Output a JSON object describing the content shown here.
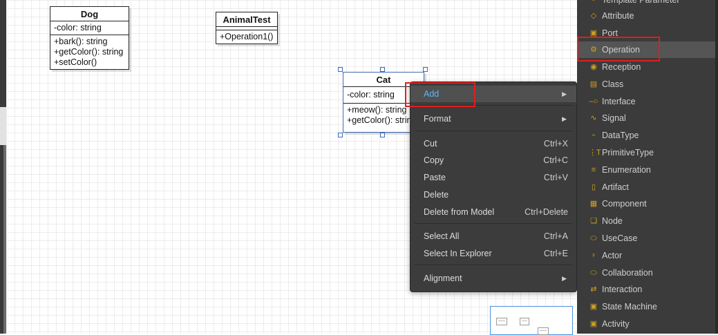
{
  "diagram": {
    "classes": [
      {
        "name": "Dog",
        "attributes": [
          "-color: string"
        ],
        "operations": [
          "+bark(): string",
          "+getColor(): string",
          "+setColor()"
        ]
      },
      {
        "name": "AnimalTest",
        "attributes": [],
        "operations": [
          "+Operation1()"
        ]
      },
      {
        "name": "Cat",
        "attributes": [
          "-color: string"
        ],
        "operations": [
          "+meow(): string",
          "+getColor(): string"
        ]
      }
    ]
  },
  "context_menu": {
    "items": [
      {
        "label": "Add",
        "shortcut": "",
        "submenu": true,
        "active": true
      },
      {
        "label": "Format",
        "shortcut": "",
        "submenu": true
      },
      {
        "label": "Cut",
        "shortcut": "Ctrl+X"
      },
      {
        "label": "Copy",
        "shortcut": "Ctrl+C"
      },
      {
        "label": "Paste",
        "shortcut": "Ctrl+V"
      },
      {
        "label": "Delete",
        "shortcut": ""
      },
      {
        "label": "Delete from Model",
        "shortcut": "Ctrl+Delete"
      },
      {
        "label": "Select All",
        "shortcut": "Ctrl+A"
      },
      {
        "label": "Select In Explorer",
        "shortcut": "Ctrl+E"
      },
      {
        "label": "Alignment",
        "shortcut": "",
        "submenu": true
      }
    ]
  },
  "palette": {
    "items": [
      {
        "label": "Template Parameter",
        "icon": "template-parameter-icon"
      },
      {
        "label": "Attribute",
        "icon": "attribute-icon"
      },
      {
        "label": "Port",
        "icon": "port-icon"
      },
      {
        "label": "Operation",
        "icon": "operation-icon",
        "selected": true
      },
      {
        "label": "Reception",
        "icon": "reception-icon"
      },
      {
        "label": "Class",
        "icon": "class-icon"
      },
      {
        "label": "Interface",
        "icon": "interface-icon"
      },
      {
        "label": "Signal",
        "icon": "signal-icon"
      },
      {
        "label": "DataType",
        "icon": "datatype-icon"
      },
      {
        "label": "PrimitiveType",
        "icon": "primitivetype-icon"
      },
      {
        "label": "Enumeration",
        "icon": "enumeration-icon"
      },
      {
        "label": "Artifact",
        "icon": "artifact-icon"
      },
      {
        "label": "Component",
        "icon": "component-icon"
      },
      {
        "label": "Node",
        "icon": "node-icon"
      },
      {
        "label": "UseCase",
        "icon": "usecase-icon"
      },
      {
        "label": "Actor",
        "icon": "actor-icon"
      },
      {
        "label": "Collaboration",
        "icon": "collaboration-icon"
      },
      {
        "label": "Interaction",
        "icon": "interaction-icon"
      },
      {
        "label": "State Machine",
        "icon": "state-machine-icon"
      },
      {
        "label": "Activity",
        "icon": "activity-icon"
      }
    ]
  },
  "colors": {
    "menu_bg": "#3c3c3c",
    "palette_bg": "#3b3b3b",
    "highlight_red": "#e01e1e",
    "active_text": "#5fb4f5",
    "icon_accent": "#d0a020",
    "selection_blue": "#3d6ab3"
  }
}
